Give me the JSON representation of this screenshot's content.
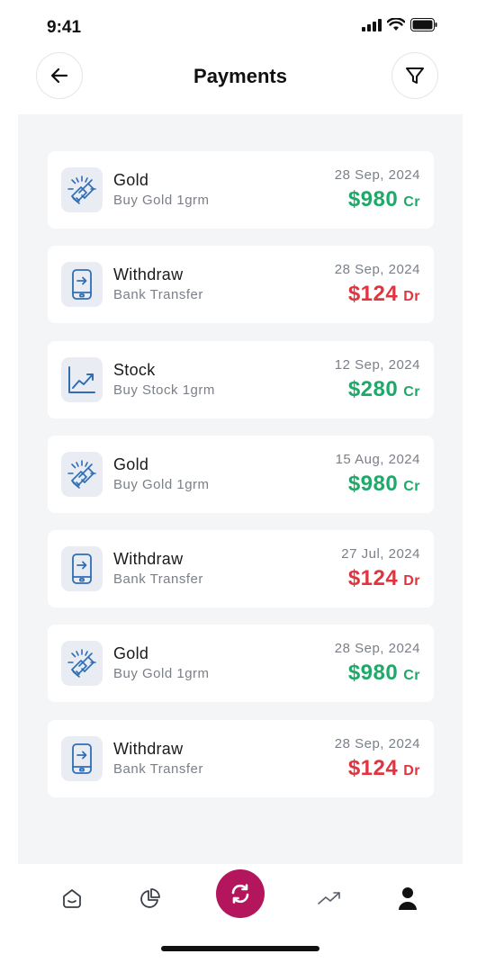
{
  "status": {
    "time": "9:41"
  },
  "header": {
    "title": "Payments"
  },
  "transactions": [
    {
      "name": "Gold",
      "sub": "Buy Gold 1grm",
      "date": "28 Sep, 2024",
      "amount": "$980",
      "type": "Cr",
      "icon": "gold-icon"
    },
    {
      "name": "Withdraw",
      "sub": "Bank Transfer",
      "date": "28 Sep, 2024",
      "amount": "$124",
      "type": "Dr",
      "icon": "phone-transfer-icon"
    },
    {
      "name": "Stock",
      "sub": "Buy Stock 1grm",
      "date": "12 Sep, 2024",
      "amount": "$280",
      "type": "Cr",
      "icon": "chart-up-icon"
    },
    {
      "name": "Gold",
      "sub": "Buy Gold 1grm",
      "date": "15 Aug, 2024",
      "amount": "$980",
      "type": "Cr",
      "icon": "gold-icon"
    },
    {
      "name": "Withdraw",
      "sub": "Bank Transfer",
      "date": "27 Jul, 2024",
      "amount": "$124",
      "type": "Dr",
      "icon": "phone-transfer-icon"
    },
    {
      "name": "Gold",
      "sub": "Buy Gold 1grm",
      "date": "28 Sep, 2024",
      "amount": "$980",
      "type": "Cr",
      "icon": "gold-icon"
    },
    {
      "name": "Withdraw",
      "sub": "Bank Transfer",
      "date": "28 Sep, 2024",
      "amount": "$124",
      "type": "Dr",
      "icon": "phone-transfer-icon"
    }
  ],
  "colors": {
    "credit": "#1fa968",
    "debit": "#e0343f",
    "accent": "#b4165e",
    "iconBlue": "#2f6db5"
  },
  "tabbar": {
    "items": [
      {
        "icon": "home-icon"
      },
      {
        "icon": "pie-chart-icon"
      },
      {
        "icon": "refresh-icon",
        "active": true
      },
      {
        "icon": "trend-icon"
      },
      {
        "icon": "profile-icon"
      }
    ]
  }
}
